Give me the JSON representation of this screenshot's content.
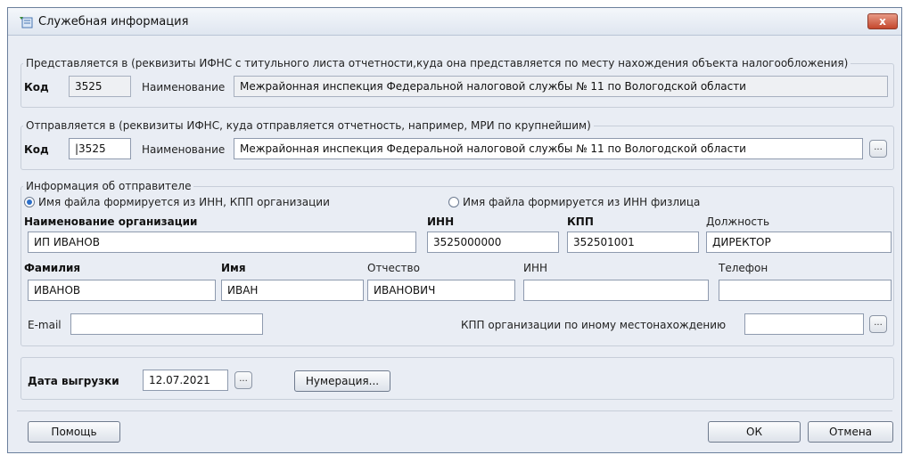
{
  "window": {
    "title": "Служебная информация",
    "close_label": "x"
  },
  "represent": {
    "legend": "Представляется в (реквизиты ИФНС с титульного листа отчетности,куда она представляется по месту нахождения объекта налогообложения)",
    "code_label": "Код",
    "code_value": "3525",
    "name_label": "Наименование",
    "name_value": "Межрайонная инспекция Федеральной налоговой службы № 11 по Вологодской области"
  },
  "sent": {
    "legend": "Отправляется в (реквизиты ИФНС, куда отправляется отчетность, например, МРИ по крупнейшим)",
    "code_label": "Код",
    "code_value": "|3525",
    "name_label": "Наименование",
    "name_value": "Межрайонная инспекция Федеральной налоговой службы № 11 по Вологодской области",
    "browse_label": "..."
  },
  "sender": {
    "legend": "Информация об отправителе",
    "radio_org": "Имя файла формируется из ИНН, КПП организации",
    "radio_person": "Имя файла формируется из ИНН физлица",
    "org_name_label": "Наименование организации",
    "org_name_value": "ИП ИВАНОВ",
    "inn_label": "ИНН",
    "inn_value": "3525000000",
    "kpp_label": "КПП",
    "kpp_value": "352501001",
    "position_label": "Должность",
    "position_value": "ДИРЕКТОР",
    "surname_label": "Фамилия",
    "surname_value": "ИВАНОВ",
    "firstname_label": "Имя",
    "firstname_value": "ИВАН",
    "patronymic_label": "Отчество",
    "patronymic_value": "ИВАНОВИЧ",
    "person_inn_label": "ИНН",
    "person_inn_value": "",
    "phone_label": "Телефон",
    "phone_value": "",
    "email_label": "E-mail",
    "email_value": "",
    "other_kpp_label": "КПП организации по иному местонахождению",
    "other_kpp_value": "",
    "browse_label": "..."
  },
  "export": {
    "date_label": "Дата выгрузки",
    "date_value": "12.07.2021",
    "browse_label": "...",
    "numbering_label": "Нумерация..."
  },
  "footer": {
    "help_label": "Помощь",
    "ok_label": "ОК",
    "cancel_label": "Отмена"
  }
}
